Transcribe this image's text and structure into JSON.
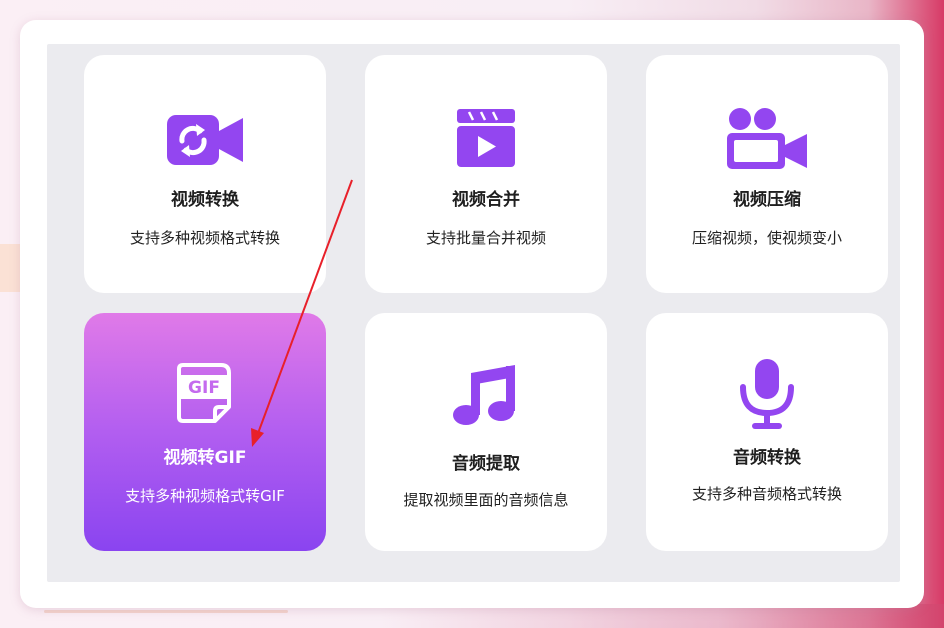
{
  "theme": {
    "accent": "#9346f0",
    "active_gradient_top": "#e07ae8",
    "active_gradient_bottom": "#8a44f0",
    "annotation_arrow": "#e8202a"
  },
  "cards": [
    {
      "title": "视频转换",
      "desc": "支持多种视频格式转换",
      "icon": "video-convert-icon",
      "active": false
    },
    {
      "title": "视频合并",
      "desc": "支持批量合并视频",
      "icon": "clapperboard-play-icon",
      "active": false
    },
    {
      "title": "视频压缩",
      "desc": "压缩视频，使视频变小",
      "icon": "video-camera-icon",
      "active": false
    },
    {
      "title": "视频转GIF",
      "desc": "支持多种视频格式转GIF",
      "icon": "gif-file-icon",
      "active": true
    },
    {
      "title": "音频提取",
      "desc": "提取视频里面的音频信息",
      "icon": "music-note-icon",
      "active": false
    },
    {
      "title": "音频转换",
      "desc": "支持多种音频格式转换",
      "icon": "microphone-icon",
      "active": false
    }
  ]
}
